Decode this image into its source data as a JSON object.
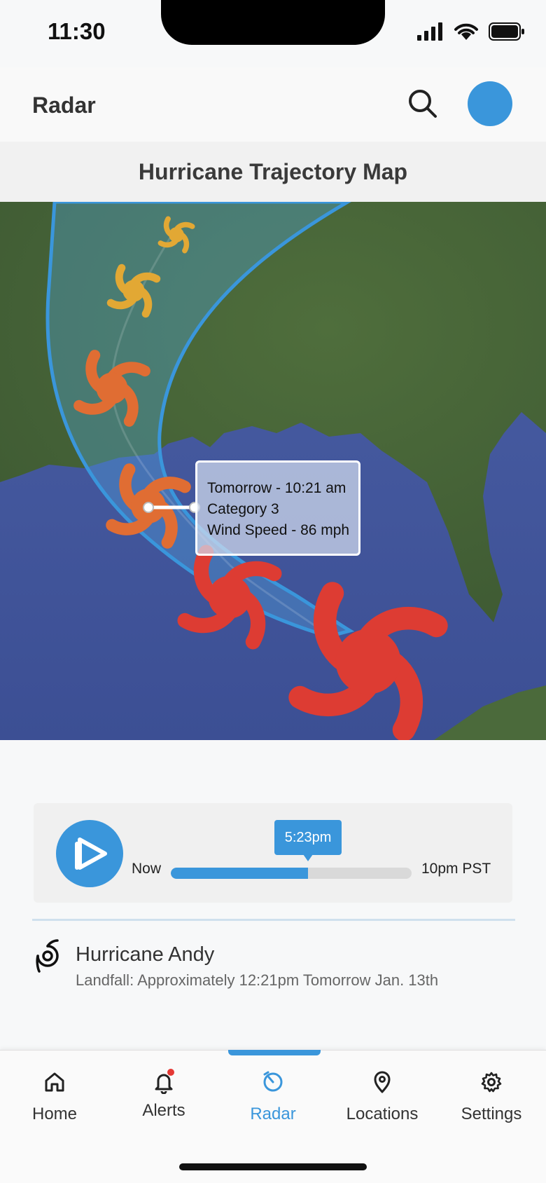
{
  "status_bar": {
    "time": "11:30"
  },
  "header": {
    "title": "Radar"
  },
  "map": {
    "title": "Hurricane Trajectory Map",
    "tooltip": {
      "time": "Tomorrow - 10:21 am",
      "category": "Category 3",
      "wind": "Wind Speed - 86 mph"
    }
  },
  "player": {
    "start_label": "Now",
    "end_label": "10pm PST",
    "current_time": "5:23pm",
    "progress": 0.57
  },
  "storm": {
    "name": "Hurricane Andy",
    "detail": "Landfall: Approximately 12:21pm Tomorrow Jan. 13th"
  },
  "tabs": [
    {
      "label": "Home",
      "icon": "home-icon"
    },
    {
      "label": "Alerts",
      "icon": "bell-icon"
    },
    {
      "label": "Radar",
      "icon": "radar-icon"
    },
    {
      "label": "Locations",
      "icon": "location-pin-icon"
    },
    {
      "label": "Settings",
      "icon": "gear-icon"
    }
  ],
  "colors": {
    "accent": "#3a96db",
    "storm_weak": "#e2a834",
    "storm_mid": "#e06d33",
    "storm_strong": "#dd3c33"
  }
}
